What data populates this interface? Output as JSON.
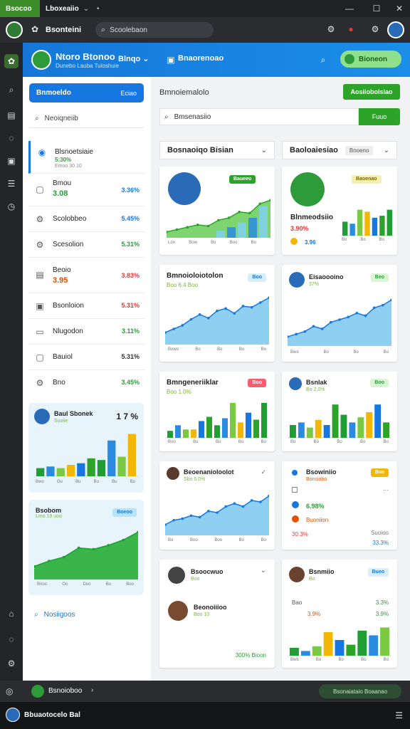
{
  "window": {
    "tabs": [
      "Bsocoo",
      "Lboxeaiio"
    ],
    "controls": [
      "—",
      "☐",
      "✕"
    ]
  },
  "toolbar": {
    "title": "Bsonteini",
    "search": "Scoolebaon"
  },
  "header": {
    "app_name": "Ntoro Btonoo",
    "app_sub": "Dunebo Lauba Tuloshuie",
    "menu": "Blnqo",
    "tab": "Bnaorenoao",
    "pill": "Bioneon"
  },
  "sidebar": {
    "button": "Bnmoeldo",
    "button_right": "Eciao",
    "search": "Neoiqneiib",
    "items": [
      {
        "label": "Blsnoetsiaie",
        "sub": "5:30%",
        "note": "Emoo 30 10",
        "val": ""
      },
      {
        "label": "Bmou",
        "sub": "3.08",
        "val": "3.36%"
      },
      {
        "label": "Scolobbeo",
        "sub": "",
        "val": "5.45%"
      },
      {
        "label": "Scesolion",
        "sub": "",
        "val": "5.31%"
      },
      {
        "label": "Beoio",
        "sub": "3.95",
        "val": "3.83%"
      },
      {
        "label": "Bsonloion",
        "sub": "",
        "val": "5.31%"
      },
      {
        "label": "Nlugodon",
        "sub": "",
        "val": "3.11%"
      },
      {
        "label": "Bauiol",
        "sub": "",
        "val": "5.31%"
      },
      {
        "label": "Bno",
        "sub": "",
        "val": "3.45%"
      }
    ],
    "card1": {
      "title": "Baul Sbonek",
      "sub": "Suoiie",
      "num": "1 7 %",
      "values": [
        5,
        6,
        5,
        7,
        8,
        11,
        10,
        22,
        12,
        26
      ],
      "axis": [
        "Bwo",
        "Ou",
        "Bu",
        "Bu",
        "Bu",
        "Bu"
      ]
    },
    "card2": {
      "title": "Bsobom",
      "sub": "Lmo 19 uoo",
      "badge": "Boeoo",
      "axis": [
        "Bnoo",
        "Oo",
        "Doo",
        "Bu",
        "Boo"
      ]
    },
    "footer": "Nosiigoos"
  },
  "main": {
    "title": "Bmnoiemalolo",
    "btn": "Aosiiobolsiao",
    "search": "Bmsenasiio",
    "filter": "Fuuo",
    "select1": "Bosnaoiqo Bisian",
    "select2": "Baoloaiesiao",
    "select2_tag": "Bnoeno",
    "cards": [
      {
        "title": "",
        "badge": "Baueeo",
        "axis": [
          "Loo",
          "Bow",
          "Bu",
          "Boo",
          "Bu"
        ]
      },
      {
        "title": "Blnmeodsiio",
        "sub": "3.90%",
        "badge": "Baoenao",
        "extra": "3.96",
        "axis": [
          "Bo",
          "Bo",
          "Bo"
        ]
      },
      {
        "title": "Bmnoioloiotolon",
        "sub": "Boo 6.4 Boo",
        "badge": "Boo",
        "axis": [
          "Bowo",
          "Bo",
          "Bo",
          "Bo",
          "Bo"
        ]
      },
      {
        "title": "Eisaoooino",
        "sub": "37%",
        "badge": "Beo",
        "axis": [
          "Bwo",
          "Bo",
          "Bo",
          "Bo"
        ]
      },
      {
        "title": "Bmngeneriiklar",
        "sub": "Boo 1.0%",
        "badge": "Boo",
        "axis": [
          "Boo",
          "Bu",
          "Bu",
          "Bo",
          "Bo"
        ]
      },
      {
        "title": "Bsnlak",
        "sub": "Bo 2.0%",
        "badge": "Boo",
        "axis": [
          "Bo",
          "Bo",
          "Bo",
          "Bo",
          "Bo"
        ]
      },
      {
        "title": "Beoenanioloolot",
        "sub": "Sbo 5.0%",
        "axis": [
          "Bo",
          "Boo",
          "Boo",
          "Bo",
          "Bo"
        ]
      },
      {
        "title": "Bsowiniio",
        "sub": "Bonsiobo",
        "badge": "Bue",
        "rows": [
          "6.98%",
          "Buoniion",
          "30.3%",
          "Suoioo",
          "33.3%"
        ]
      },
      {
        "title": "Bsoocwuo",
        "sub": "Boo",
        "title2": "Beonoiiioo",
        "sub2": "Boo 10",
        "footer": "300% Bioon"
      },
      {
        "title": "Bsnmiio",
        "sub": "Bo",
        "badge": "Bueo",
        "rows": [
          "Bao",
          "3.3%",
          "3.9%",
          "3.9%"
        ],
        "axis": [
          "Bwb",
          "Bo",
          "Bo",
          "Bo",
          "Bo"
        ]
      }
    ]
  },
  "bottombar": {
    "label": "Bsnoioboo",
    "pill": "Bsonaiataio Boaanao"
  },
  "taskbar": {
    "label": "Bbuaotocelo Bal"
  },
  "chart_data": [
    {
      "type": "area",
      "name": "card-1",
      "values": [
        10,
        14,
        18,
        22,
        20,
        30,
        34,
        44,
        42,
        58,
        64
      ],
      "bars": [
        12,
        18,
        26,
        34,
        54
      ]
    },
    {
      "type": "bar",
      "name": "card-2",
      "values": [
        14,
        12,
        26,
        24,
        18,
        20,
        26
      ]
    },
    {
      "type": "area",
      "name": "card-3",
      "values": [
        20,
        26,
        32,
        42,
        50,
        44,
        56,
        60,
        52,
        64,
        62,
        70,
        78
      ]
    },
    {
      "type": "area",
      "name": "card-4",
      "values": [
        14,
        18,
        22,
        30,
        26,
        36,
        40,
        44,
        50,
        46,
        58,
        62,
        70
      ]
    },
    {
      "type": "bar",
      "name": "card-5",
      "values": [
        10,
        18,
        12,
        12,
        24,
        30,
        18,
        28,
        50,
        22,
        36,
        26,
        50
      ]
    },
    {
      "type": "bar",
      "name": "card-6",
      "values": [
        10,
        12,
        8,
        14,
        10,
        26,
        18,
        12,
        16,
        20,
        26,
        12
      ]
    },
    {
      "type": "area",
      "name": "card-7",
      "values": [
        14,
        20,
        22,
        26,
        24,
        32,
        30,
        38,
        42,
        38,
        46,
        44,
        52
      ]
    },
    {
      "type": "bar",
      "name": "card-10",
      "values": [
        10,
        6,
        12,
        30,
        20,
        14,
        32,
        26,
        36
      ]
    },
    {
      "type": "area",
      "name": "sidebar-card-2",
      "values": [
        20,
        28,
        34,
        48,
        46,
        52,
        60,
        72
      ]
    }
  ]
}
